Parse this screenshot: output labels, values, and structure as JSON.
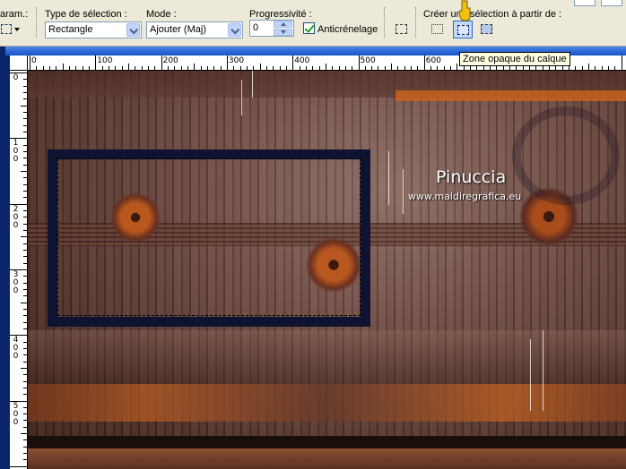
{
  "toolbar": {
    "param_label": "aram.:",
    "selection_type_label": "Type de sélection :",
    "selection_type_value": "Rectangle",
    "mode_label": "Mode :",
    "mode_value": "Ajouter (Maj)",
    "progressivity_label": "Progressivité :",
    "progressivity_value": "0",
    "antialias_label": "Anticrénelage",
    "antialias_checked": true,
    "create_from_label": "Créer une sélection à partir de :",
    "tooltip": "Zone opaque du calque"
  },
  "ruler": {
    "top_labels": [
      "0",
      "100",
      "200",
      "300",
      "400",
      "500",
      "600"
    ],
    "left_labels": [
      "0",
      "100",
      "200",
      "300",
      "400",
      "500"
    ]
  },
  "canvas": {
    "watermark_name": "Pinuccia",
    "watermark_url": "www.maidiregrafica.eu"
  },
  "icons": {
    "selection": "rectangle-selection-icon",
    "param_dropdown": "chevron-down-icon",
    "custom_selection": "custom-selection-icon",
    "from_border": "selection-border-icon",
    "from_opaque": "opaque-area-icon",
    "from_layer": "layer-selection-icon",
    "cursor": "hand-pointer-icon"
  },
  "colors": {
    "toolbar_bg": "#ece9d8",
    "frame": "#0d1330",
    "accent_orange": "#c8621e"
  }
}
